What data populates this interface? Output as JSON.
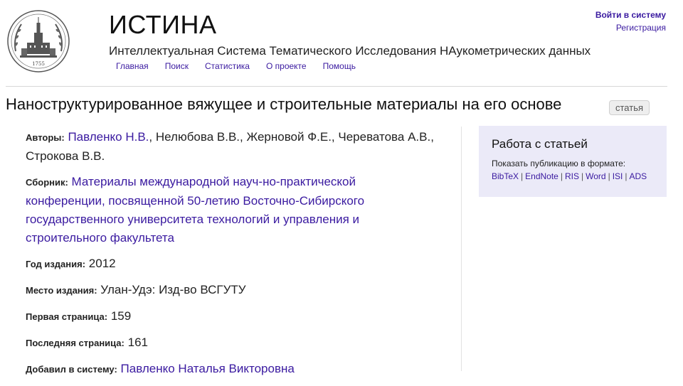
{
  "header": {
    "title": "ИСТИНА",
    "subtitle": "Интеллектуальная Система Тематического Исследования НАукометрических данных",
    "nav": [
      "Главная",
      "Поиск",
      "Статистика",
      "О проекте",
      "Помощь"
    ],
    "login_label": "Войти в систему",
    "register_label": "Регистрация",
    "logo_year": "1755"
  },
  "article": {
    "title": "Наноструктурированное вяжущее и строительные материалы на его основе",
    "type_badge": "статья",
    "authors_label": "Авторы:",
    "author_linked": "Павленко Н.В.",
    "authors_rest": ", Нелюбова В.В., Жерновой Ф.Е., Череватова А.В., Строкова В.В.",
    "collection_label": "Сборник:",
    "collection": "Материалы международной науч-но-практической конференции, посвященной 50-летию Восточно-Сибирского государственного университета технологий и управления и строительного факультета",
    "year_label": "Год издания:",
    "year": "2012",
    "place_label": "Место издания:",
    "place": "Улан-Удэ: Изд-во ВСГУТУ",
    "first_page_label": "Первая страница:",
    "first_page": "159",
    "last_page_label": "Последняя страница:",
    "last_page": "161",
    "added_by_label": "Добавил в систему:",
    "added_by": "Павленко Наталья Викторовна"
  },
  "sidebar": {
    "title": "Работа с статьей",
    "hint": "Показать публикацию в формате:",
    "formats": [
      "BibTeX",
      "EndNote",
      "RIS",
      "Word",
      "ISI",
      "ADS"
    ]
  }
}
